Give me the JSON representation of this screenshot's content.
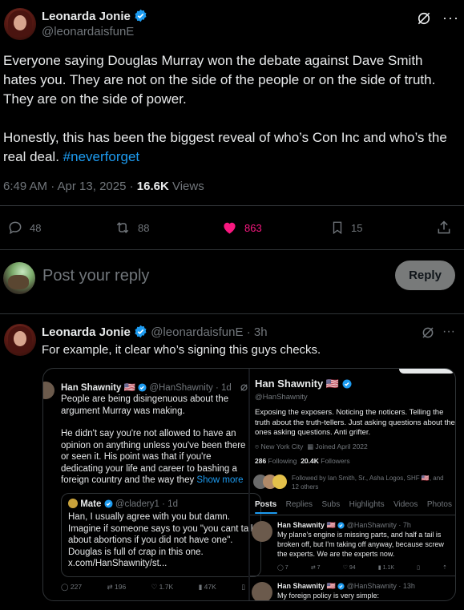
{
  "tweet": {
    "author_name": "Leonarda Jonie",
    "author_handle": "@leonardaisfunE",
    "body_line1": "Everyone saying Douglas Murray won the debate against Dave Smith hates you. They are not on the side of the people or on the side of truth. They are on the side of power.",
    "body_line2": "Honestly, this has been the biggest reveal of who’s Con Inc and who’s the real deal. ",
    "hashtag": "#neverforget",
    "timestamp": "6:49 AM · Apr 13, 2025 · ",
    "views_count": "16.6K",
    "views_label": " Views",
    "replies": "48",
    "reposts": "88",
    "likes": "863",
    "bookmarks": "15",
    "like_color": "#f91880"
  },
  "reply_box": {
    "placeholder": "Post your reply",
    "button_label": "Reply"
  },
  "reply_tweet": {
    "author_name": "Leonarda Jonie",
    "author_handle": "@leonardaisfunE",
    "age": "· 3h",
    "text": "For example, it clear who’s signing this guys checks."
  },
  "embed_left": {
    "author_name": "Han Shawnity 🇺🇸",
    "author_handle": "@HanShawnity · 1d",
    "para1": "People are being disingenuous about the argument Murray was making.",
    "para2": "He didn't say you're not allowed to have an opinion on anything unless you've been there or seen it. His point was that if you're dedicating your life and career to bashing a foreign country and the way they ",
    "show_more": "Show more",
    "quote_name": "Mate",
    "quote_handle": "@cladery1 · 1d",
    "quote_text": "Han, I usually agree with you but damn. Imagine if someone says to you \"you cant talk about abortions if you did not have one\". Douglas is full of crap in this one. x.com/HanShawnity/st...",
    "stats": [
      "227",
      "196",
      "1.7K",
      "47K"
    ]
  },
  "embed_right": {
    "name": "Han Shawnity 🇺🇸",
    "handle": "@HanShawnity",
    "bio": "Exposing the exposers. Noticing the noticers. Telling the truth about the truth-tellers. Just asking questions about the ones asking questions. Anti grifter.",
    "location": "New York City",
    "joined": "Joined April 2022",
    "following_count": "286",
    "following_label": " Following",
    "followers_count": "20.4K",
    "followers_label": " Followers",
    "followed_by": "Followed by Ian Smith, Sr., Asha Logos, SHF 🇺🇸, and 12 others",
    "tabs": [
      "Posts",
      "Replies",
      "Subs",
      "Highlights",
      "Videos",
      "Photos"
    ],
    "post1_author": "Han Shawnity 🇺🇸",
    "post1_meta": "@HanShawnity · 7h",
    "post1_text": "My plane's engine is missing parts, and half a tail is broken off, but I'm taking off anyway, because screw the experts. We are the experts now.",
    "post1_stats": [
      "7",
      "7",
      "94",
      "1.1K"
    ],
    "post2_author": "Han Shawnity 🇺🇸",
    "post2_meta": "@HanShawnity · 13h",
    "post2_text": "My foreign policy is very simple:"
  }
}
